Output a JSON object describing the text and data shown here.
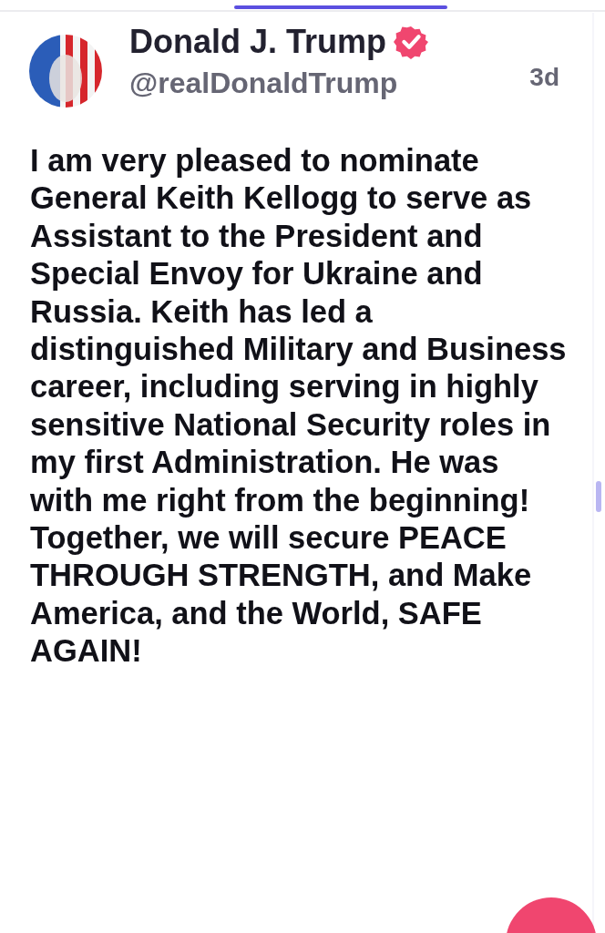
{
  "post": {
    "author": "Donald J. Trump",
    "verified": true,
    "handle": "@realDonaldTrump",
    "time": "3d",
    "text": "I am very pleased to nominate General Keith Kellogg to serve as Assistant to the President and Special Envoy for Ukraine and Russia. Keith has led a distinguished Military and Business career, including serving in highly sensitive National Security roles in my first Administration. He was with me right from the beginning! Together, we will secure PEACE THROUGH STRENGTH, and Make America, and the World, SAFE AGAIN!"
  }
}
